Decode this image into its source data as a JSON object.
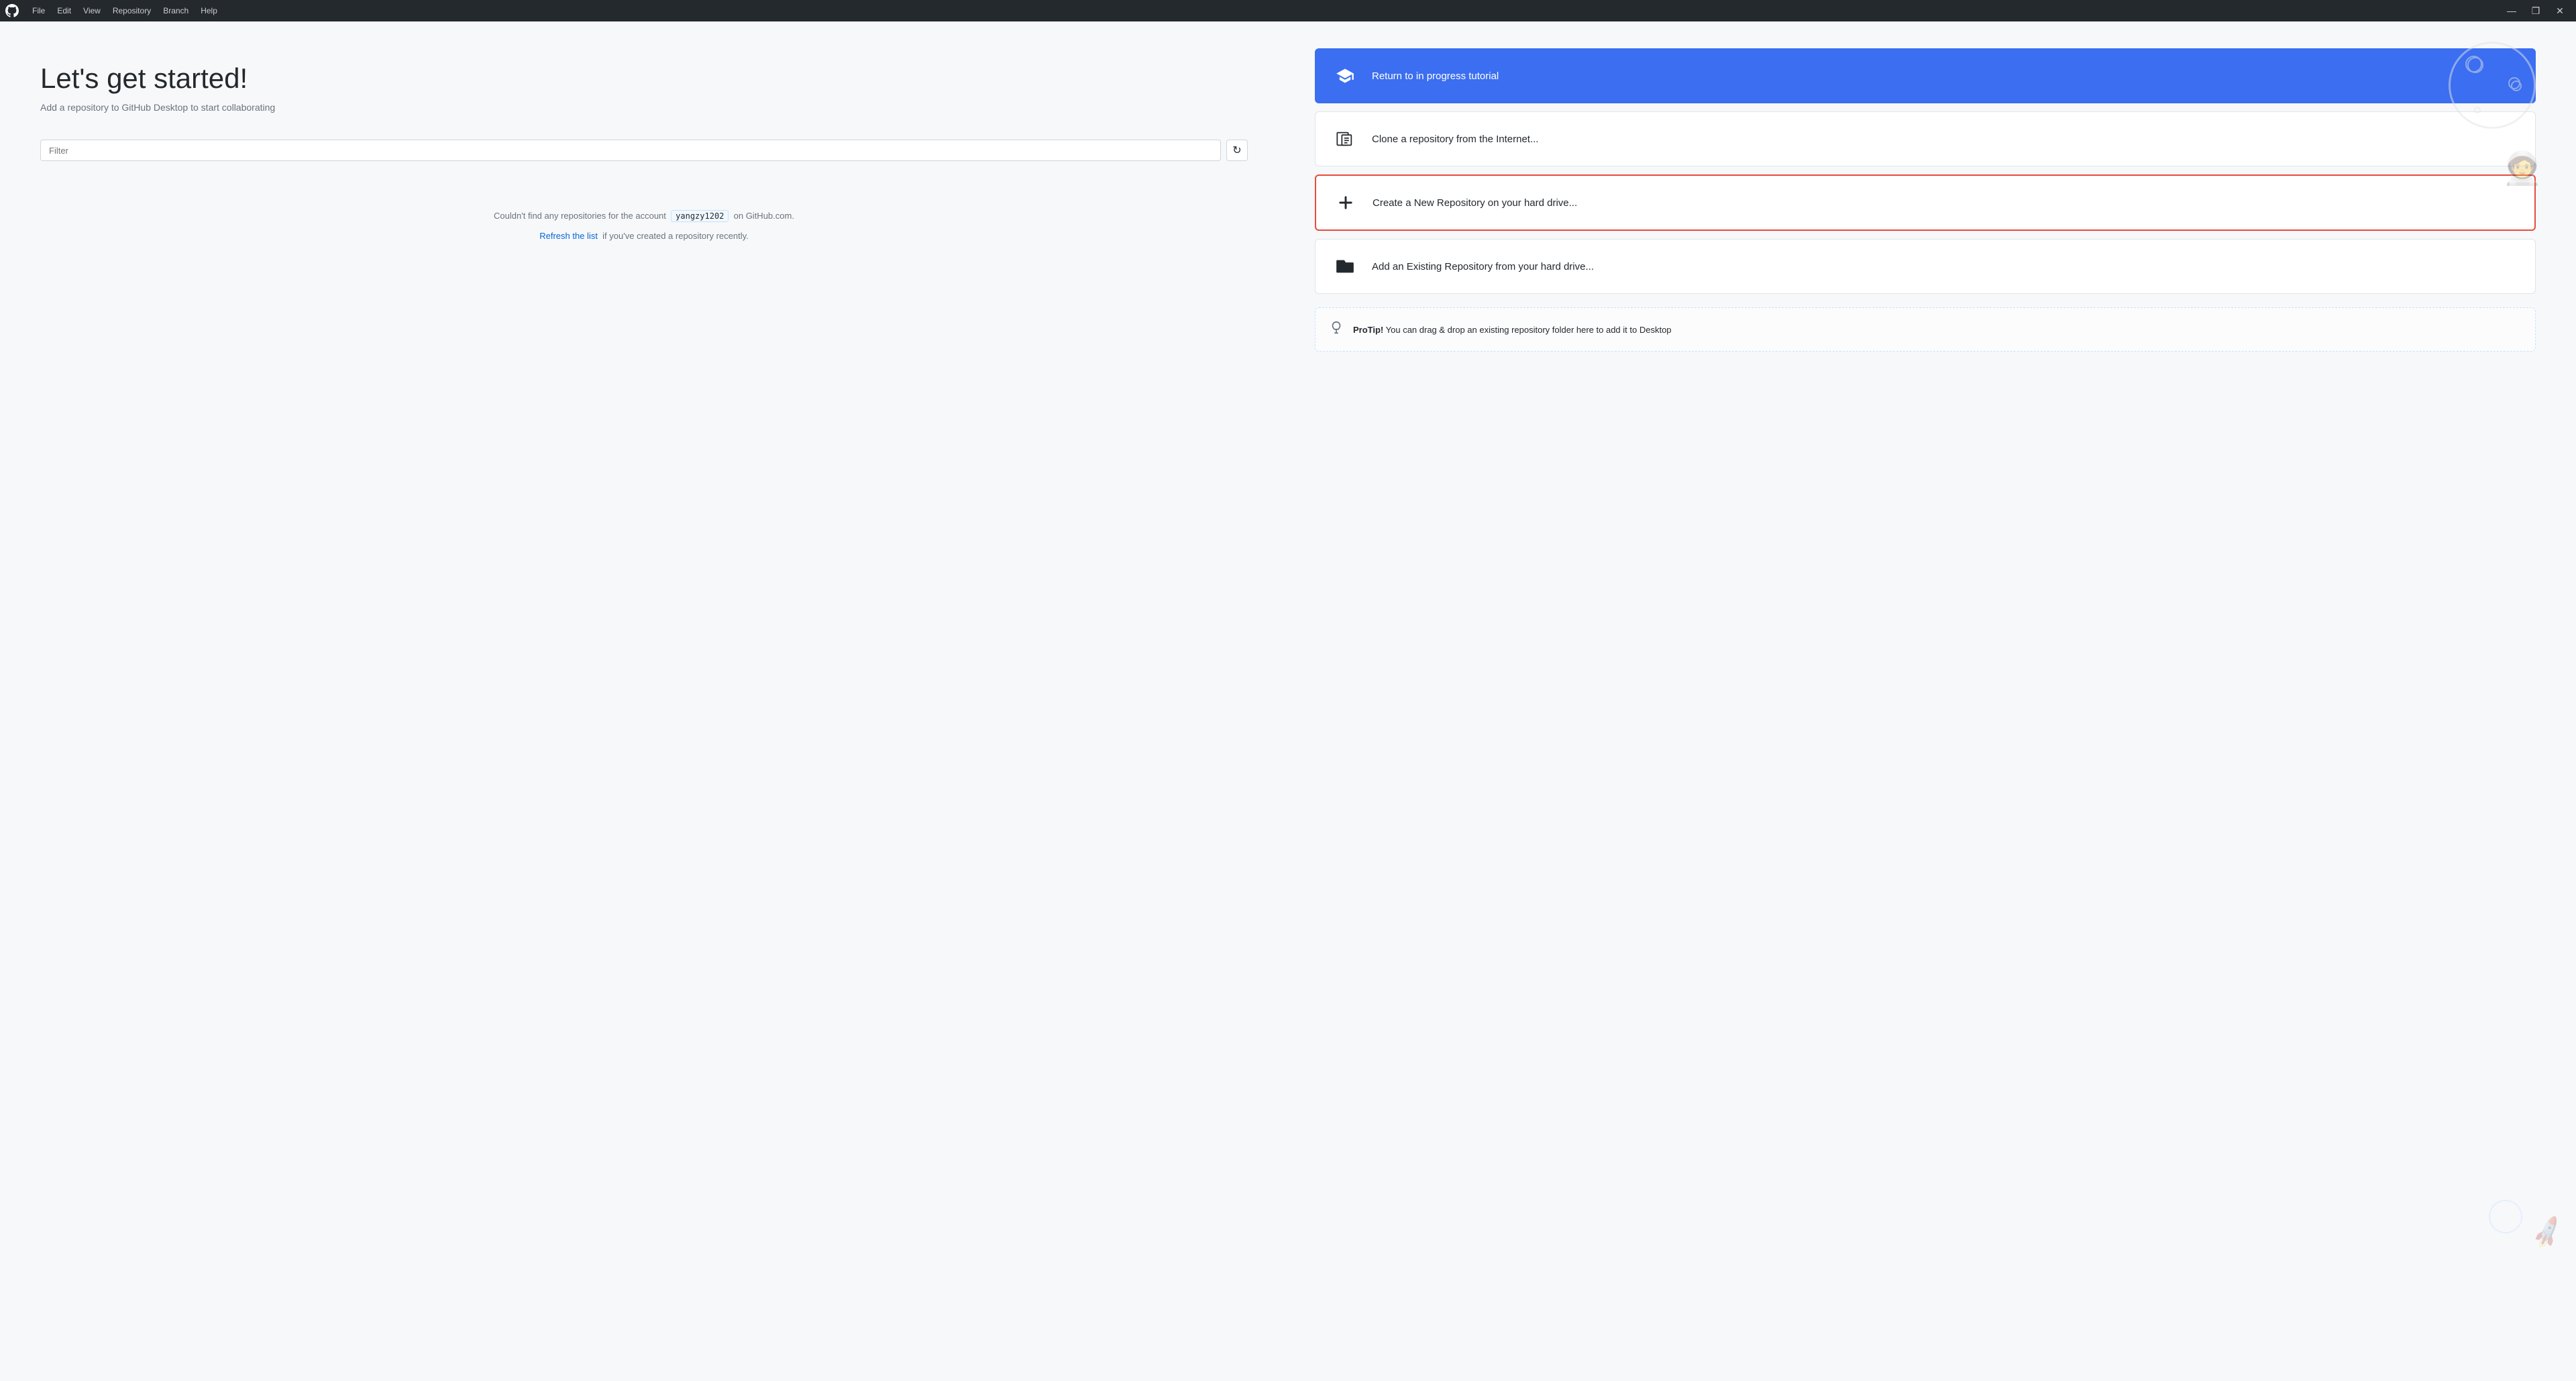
{
  "titlebar": {
    "logo_alt": "GitHub",
    "menu_items": [
      "File",
      "Edit",
      "View",
      "Repository",
      "Branch",
      "Help"
    ],
    "controls": {
      "minimize": "—",
      "maximize": "❐",
      "close": "✕"
    }
  },
  "welcome": {
    "title": "Let's get started!",
    "subtitle": "Add a repository to GitHub Desktop to start collaborating"
  },
  "filter": {
    "placeholder": "Filter",
    "refresh_icon": "↻"
  },
  "empty_state": {
    "prefix": "Couldn't find any repositories for the account",
    "account": "yangzy1202",
    "suffix": "on GitHub.com.",
    "refresh_link": "Refresh the list",
    "refresh_suffix": "if you've created a repository recently."
  },
  "actions": {
    "tutorial": {
      "label": "Return to in progress tutorial"
    },
    "clone": {
      "label": "Clone a repository from the Internet..."
    },
    "create": {
      "label": "Create a New Repository on your hard drive..."
    },
    "add_existing": {
      "label": "Add an Existing Repository from your hard drive..."
    }
  },
  "protip": {
    "bold": "ProTip!",
    "text": " You can drag & drop an existing repository folder here to add it to Desktop"
  },
  "colors": {
    "tutorial_bg": "#3b6ef0",
    "highlight_border": "#e74c3c",
    "link": "#0366d6"
  }
}
